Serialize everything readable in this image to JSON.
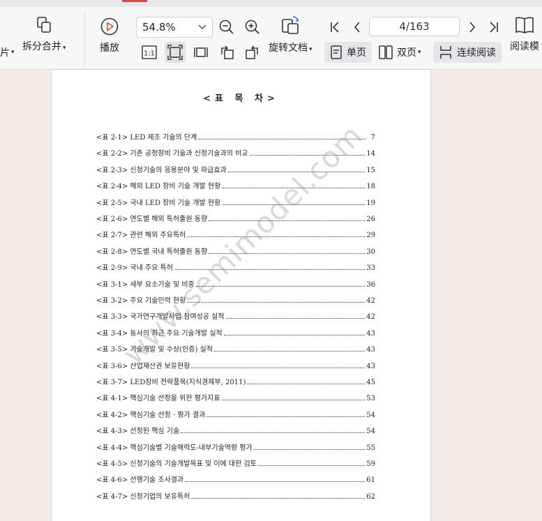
{
  "toolbar": {
    "left_partial_label": "片",
    "split_merge": "拆分合并",
    "play": "播放",
    "zoom": "54.8%",
    "rotate": "旋转文档",
    "page_indicator": "4/163",
    "single_page": "单页",
    "double_page": "双页",
    "continuous": "连续阅读",
    "read_mode": "阅读模",
    "one_to_one": "1:1"
  },
  "document": {
    "title": "<표 목 차>",
    "watermark": "www.semimodel.com",
    "toc": [
      {
        "label": "<표 2-1> LED 제조 기술의 단계",
        "page": "7"
      },
      {
        "label": "<표 2-2> 기존 공정장비 기술과 신청기술과의 비교",
        "page": "14"
      },
      {
        "label": "<표 2-3> 신청기술의 응용분야 및 파급효과",
        "page": "15"
      },
      {
        "label": "<표 2-4> 해외 LED 장비 기술 개발 현황",
        "page": "18"
      },
      {
        "label": "<표 2-5> 국내 LED 장비 기술 개발 현황",
        "page": "19"
      },
      {
        "label": "<표 2-6> 연도별 해외 특허출원 동향",
        "page": "26"
      },
      {
        "label": "<표 2-7> 관련 해외 주요특허",
        "page": "29"
      },
      {
        "label": "<표 2-8> 연도별 국내 특허출원 동향",
        "page": "30"
      },
      {
        "label": "<표 2-9> 국내 주요 특허",
        "page": "33"
      },
      {
        "label": "<표 3-1> 세부 요소기술 및 비중",
        "page": "36"
      },
      {
        "label": "<표 3-2> 주요 기술인력 현황",
        "page": "42"
      },
      {
        "label": "<표 3-3> 국가연구개발사업 참여성공 실적",
        "page": "42"
      },
      {
        "label": "<표 3-4> 동사의 최근 주요 기술개발 실적",
        "page": "43"
      },
      {
        "label": "<표 3-5> 기술개발 및 수상(인증) 실적",
        "page": "43"
      },
      {
        "label": "<표 3-6> 산업재산권 보유현황",
        "page": "43"
      },
      {
        "label": "<표 3-7> LED장비 전략품목(지식경제부, 2011)",
        "page": "45"
      },
      {
        "label": "<표 4-1> 핵심기술 선정을 위한 평가지표",
        "page": "53"
      },
      {
        "label": "<표 4-2> 핵심기술 선정 · 평가 결과",
        "page": "54"
      },
      {
        "label": "<표 4-3> 선정된 핵심 기술",
        "page": "54"
      },
      {
        "label": "<표 4-4> 핵심기술별 기술매력도-내부기술역량 평가",
        "page": "55"
      },
      {
        "label": "<표 4-5> 신청기술의 기술개발목표 및 이에 대한 검토",
        "page": "59"
      },
      {
        "label": "<표 4-6> 선행기술 조사결과",
        "page": "61"
      },
      {
        "label": "<표 4-7> 신청기업의 보유특허",
        "page": "62"
      }
    ]
  }
}
